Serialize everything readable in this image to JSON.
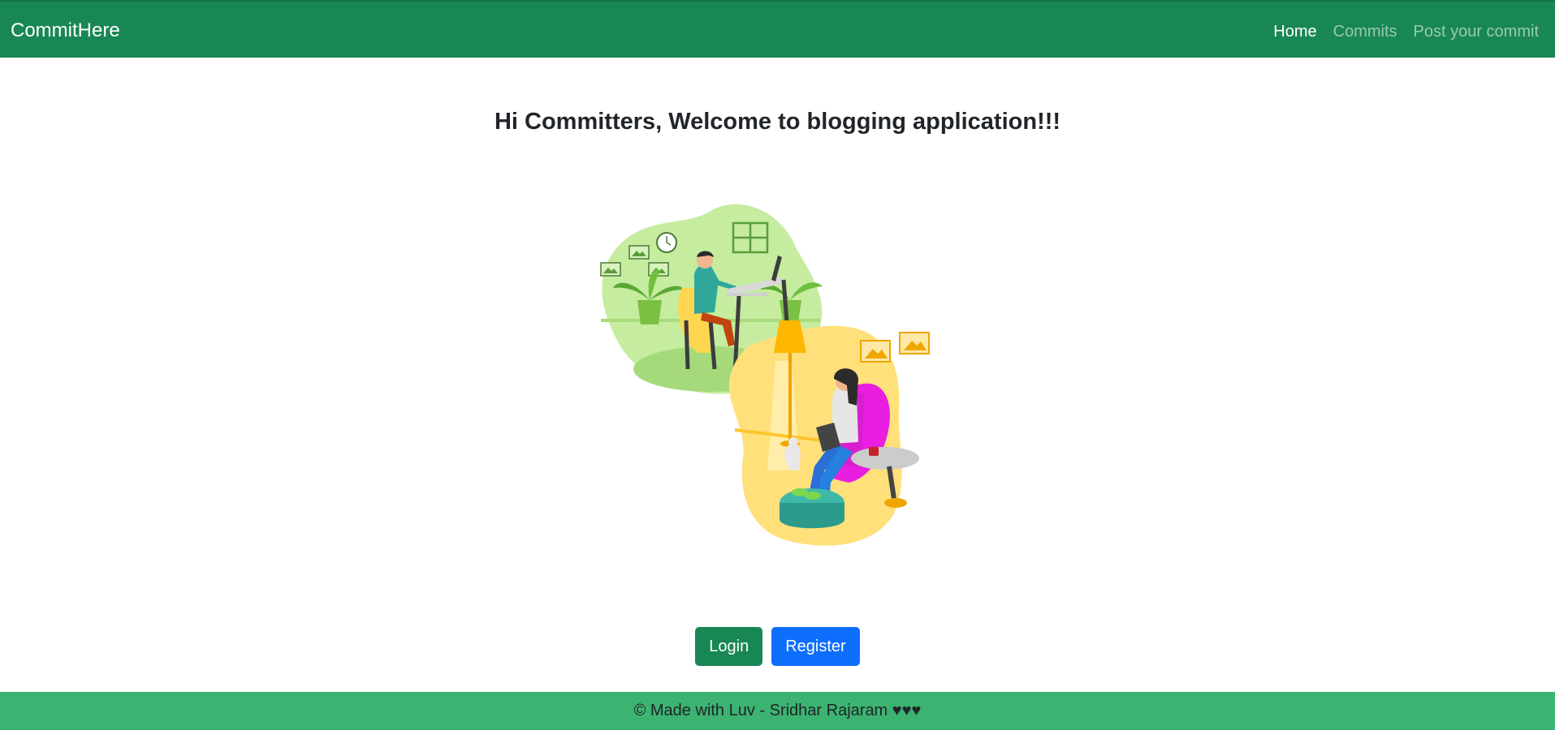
{
  "navbar": {
    "brand": "CommitHere",
    "links": [
      {
        "label": "Home",
        "active": true
      },
      {
        "label": "Commits",
        "active": false
      },
      {
        "label": "Post your commit",
        "active": false
      }
    ],
    "background": "#198754"
  },
  "main": {
    "headline": "Hi Committers, Welcome to blogging application!!!",
    "illustration_icon": "people-working-illustration"
  },
  "actions": {
    "login_label": "Login",
    "register_label": "Register",
    "login_color": "#198754",
    "register_color": "#0d6efd"
  },
  "footer": {
    "text": "© Made with Luv - Sridhar Rajaram ♥♥♥",
    "background": "#3cb371"
  }
}
